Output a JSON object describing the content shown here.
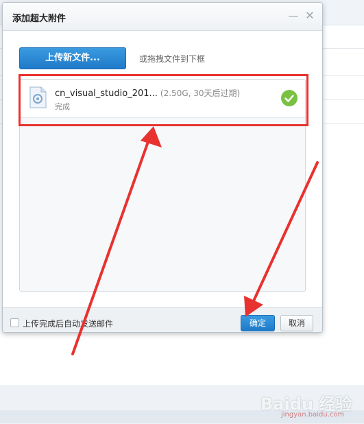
{
  "dialog": {
    "title": "添加超大附件",
    "minimize_glyph": "—",
    "close_glyph": "✕"
  },
  "toolbar": {
    "upload_label": "上传新文件...",
    "drag_hint": "或拖拽文件到下框"
  },
  "files": [
    {
      "name": "cn_visual_studio_201...",
      "size": "(2.50G, 30天后过期)",
      "status": "完成",
      "icon": "document-icon",
      "status_icon": "check-circle-icon"
    }
  ],
  "footer": {
    "auto_send_label": "上传完成后自动发送邮件",
    "auto_send_checked": false,
    "ok_label": "确定",
    "cancel_label": "取消"
  },
  "watermark": {
    "brand": "Baidu 经验",
    "sub": "jingyan.baidu.com"
  },
  "colors": {
    "accent": "#1f7ac9",
    "highlight": "#e8322f",
    "success": "#7ac143"
  }
}
